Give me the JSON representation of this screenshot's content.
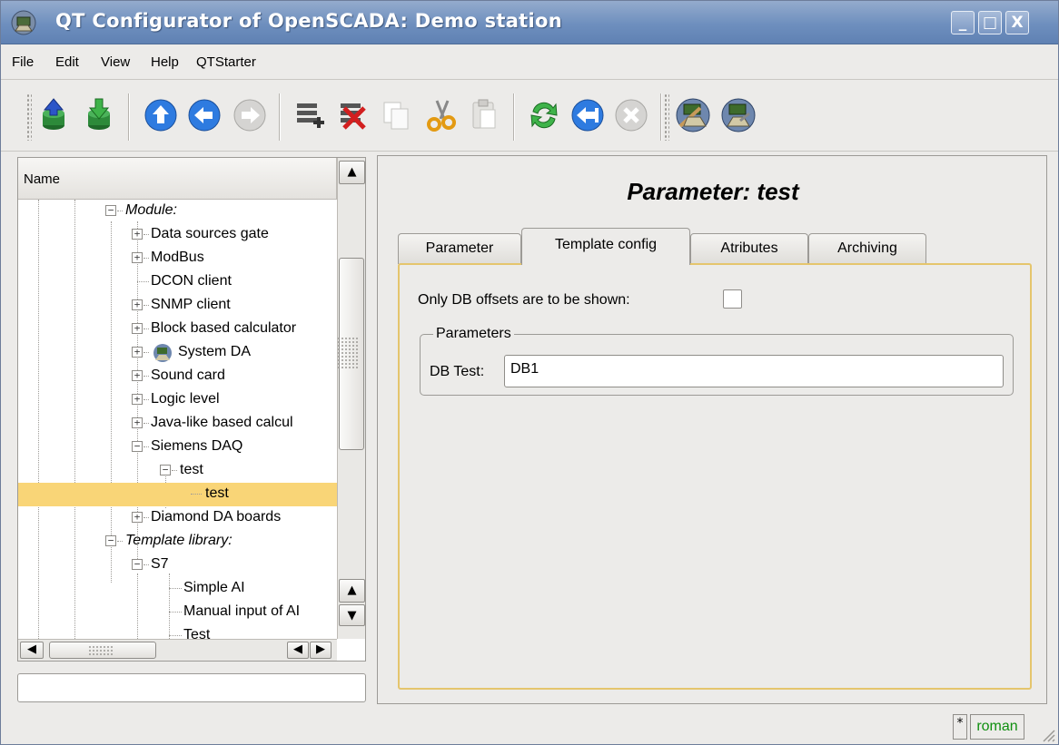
{
  "window": {
    "title": "QT Configurator of OpenSCADA: Demo station",
    "buttons": {
      "minimize": "_",
      "maximize": "□",
      "close": "X"
    }
  },
  "menu": {
    "items": [
      "File",
      "Edit",
      "View",
      "Help",
      "QTStarter"
    ]
  },
  "toolbar": {
    "icons": [
      "db-load-icon",
      "db-save-icon",
      "up-icon",
      "back-icon",
      "forward-icon",
      "item-add-icon",
      "item-delete-icon",
      "copy-icon",
      "cut-icon",
      "paste-icon",
      "refresh-icon",
      "start-icon",
      "stop-icon",
      "configurator-icon",
      "station-icon"
    ]
  },
  "tree": {
    "header": "Name",
    "rows": [
      {
        "label": "Module:",
        "italic": true
      },
      {
        "label": "Data sources gate"
      },
      {
        "label": "ModBus"
      },
      {
        "label": "DCON client"
      },
      {
        "label": "SNMP client"
      },
      {
        "label": "Block based calculator"
      },
      {
        "label": "System DA"
      },
      {
        "label": "Sound card"
      },
      {
        "label": "Logic level"
      },
      {
        "label": "Java-like based calcul"
      },
      {
        "label": "Siemens DAQ"
      },
      {
        "label": "test"
      },
      {
        "label": "test",
        "selected": true
      },
      {
        "label": "Diamond DA boards"
      },
      {
        "label": "Template library:",
        "italic": true
      },
      {
        "label": "S7"
      },
      {
        "label": "Simple AI"
      },
      {
        "label": "Manual input of AI"
      },
      {
        "label": "Test"
      }
    ]
  },
  "status_input": {
    "value": ""
  },
  "page": {
    "title": "Parameter: test",
    "tabs": [
      {
        "label": "Parameter"
      },
      {
        "label": "Template config",
        "active": true
      },
      {
        "label": "Atributes"
      },
      {
        "label": "Archiving"
      }
    ],
    "only_db_offsets_label": "Only DB offsets are to be shown:",
    "only_db_offsets_checked": false,
    "group": {
      "legend": "Parameters",
      "field_label": "DB Test:",
      "field_value": "DB1"
    }
  },
  "statusbar": {
    "modified_indicator": "*",
    "user": "roman"
  },
  "colors": {
    "title_bar": "#6e8fbe",
    "selection": "#f9d577",
    "pane_border": "#e5c56d",
    "user_text": "#0f8f0f"
  }
}
